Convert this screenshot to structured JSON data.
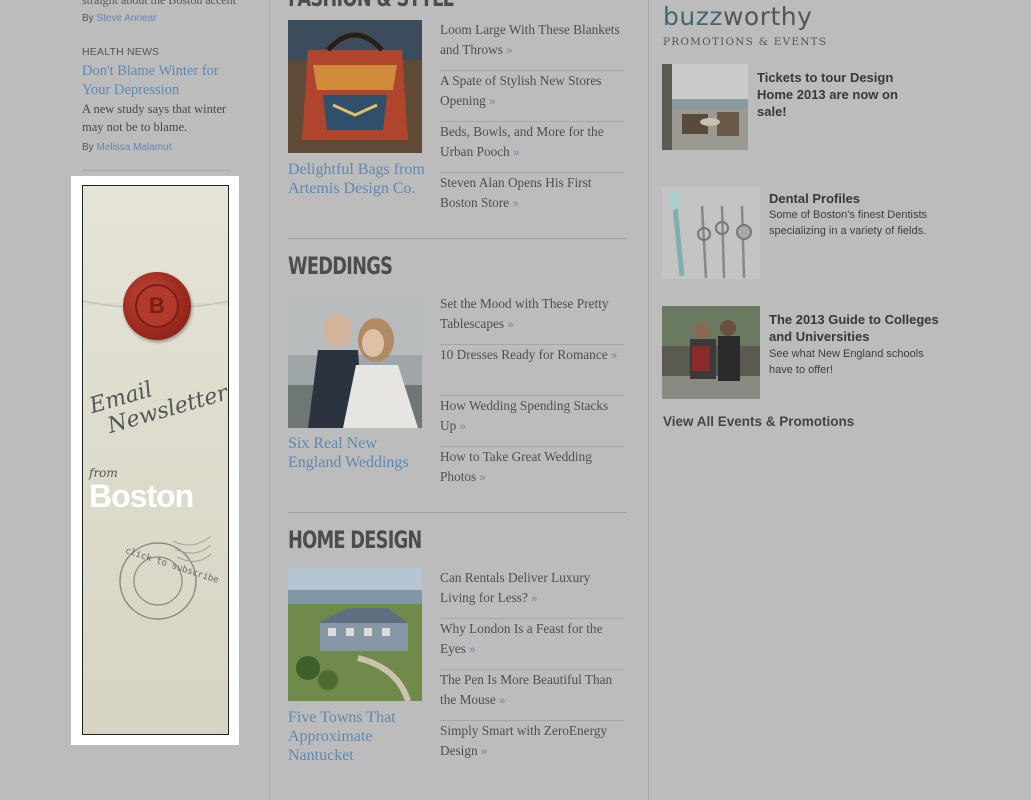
{
  "left": {
    "top_snippet": "straight about the Boston accent",
    "top_byline_prefix": "By",
    "top_byline_author": "Steve Annear",
    "health": {
      "label": "HEALTH NEWS",
      "headline": "Don't Blame Winter for Your Depression",
      "dek": "A new study says that winter may not be to blame.",
      "byline_prefix": "By",
      "author": "Melissa Malamut"
    },
    "ad": {
      "seal_letter": "B",
      "email_line1": "Email",
      "email_line2": "Newsletters",
      "from": "from",
      "boston": "Boston",
      "cta": "click to subscribe"
    }
  },
  "sections": [
    {
      "title": "FASHION & STYLE",
      "feature_caption": "Delightful Bags from Artemis Design Co.",
      "stories": [
        {
          "text": "Loom Large With These Blankets and Throws"
        },
        {
          "text": "A Spate of Stylish New Stores Opening"
        },
        {
          "text": "Beds, Bowls, and More for the Urban Pooch"
        },
        {
          "text": "Steven Alan Opens His First Boston Store"
        }
      ]
    },
    {
      "title": "WEDDINGS",
      "feature_caption": "Six Real New England Weddings",
      "stories": [
        {
          "text": "Set the Mood with These Pretty Tablescapes"
        },
        {
          "text": "10 Dresses Ready for Romance"
        },
        {
          "text": "How Wedding Spending Stacks Up"
        },
        {
          "text": "How to Take Great Wedding Photos"
        }
      ]
    },
    {
      "title": "HOME DESIGN",
      "feature_caption": "Five Towns That Approximate Nantucket",
      "stories": [
        {
          "text": "Can Rentals Deliver Luxury Living for Less?"
        },
        {
          "text": "Why London Is a Feast for the Eyes"
        },
        {
          "text": "The Pen Is More Beautiful Than the Mouse"
        },
        {
          "text": "Simply Smart with ZeroEnergy Design"
        }
      ]
    }
  ],
  "chevron": "»",
  "buzzworthy": {
    "logo_buzz": "buzz",
    "logo_worthy": "worthy",
    "subtitle": "PROMOTIONS & EVENTS",
    "promos": [
      {
        "title": "Tickets to tour Design Home 2013 are now on sale!",
        "desc": ""
      },
      {
        "title": "Dental Profiles",
        "desc": "Some of Boston's finest Dentists specializing in a variety of fields."
      },
      {
        "title": "The 2013 Guide to Colleges and Universities",
        "desc": "See what New England schools have to offer!"
      }
    ],
    "view_all": "View All Events & Promotions"
  },
  "colors": {
    "link_blue": "#5f88b2",
    "background": "#bcbcbc",
    "seal_red": "#9d2a1f",
    "logo_teal": "#436671"
  }
}
